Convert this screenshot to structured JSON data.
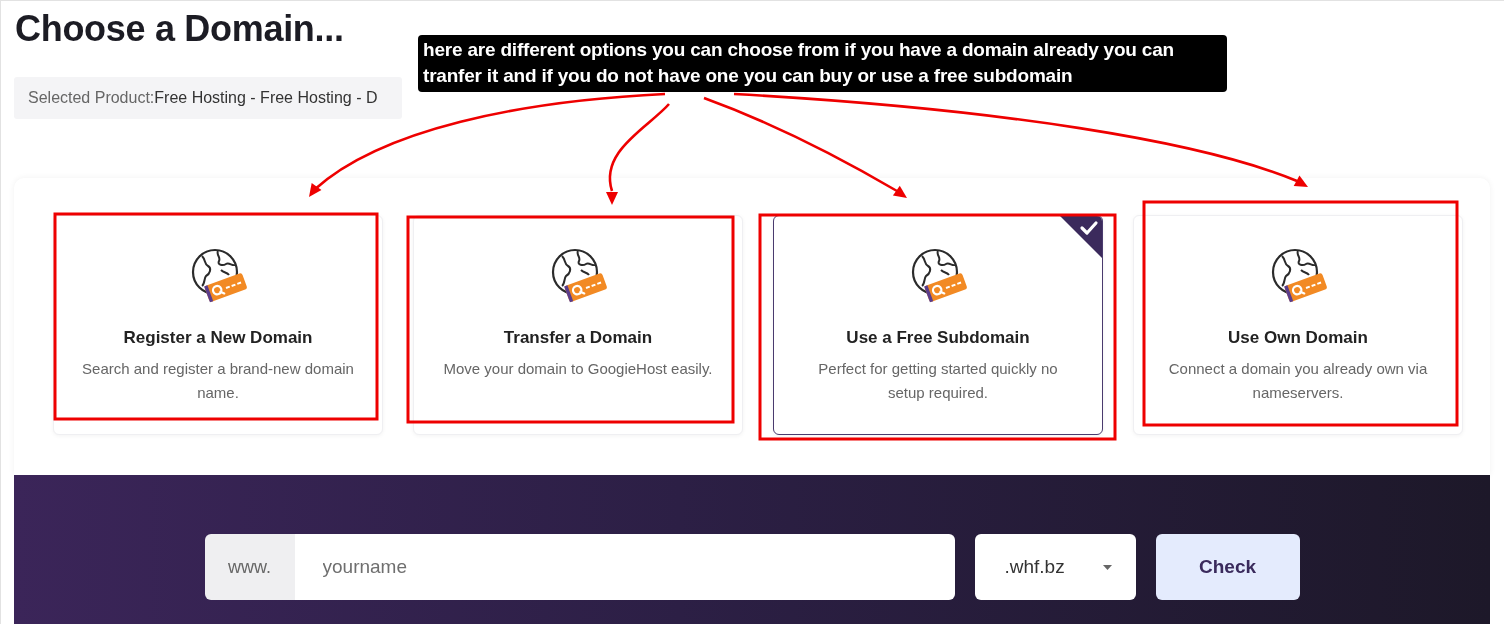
{
  "page": {
    "title": "Choose a Domain..."
  },
  "selected_product": {
    "label": "Selected Product:",
    "value": "Free Hosting - Free Hosting - D"
  },
  "annotation": {
    "note": "here are different options you can choose from if you have a domain already you can tranfer it and if you do not have one you can buy or use a free subdomain"
  },
  "domain_options": [
    {
      "title": "Register a New Domain",
      "description": "Search and register a brand-new domain name.",
      "selected": false
    },
    {
      "title": "Transfer a Domain",
      "description": "Move your domain to GoogieHost easily.",
      "selected": false
    },
    {
      "title": "Use a Free Subdomain",
      "description": "Perfect for getting started quickly no setup required.",
      "selected": true
    },
    {
      "title": "Use Own Domain",
      "description": "Connect a domain you already own via nameservers.",
      "selected": false
    }
  ],
  "domain_search": {
    "prefix": "www.",
    "placeholder": "yourname",
    "extension": ".whf.bz",
    "button": "Check"
  }
}
